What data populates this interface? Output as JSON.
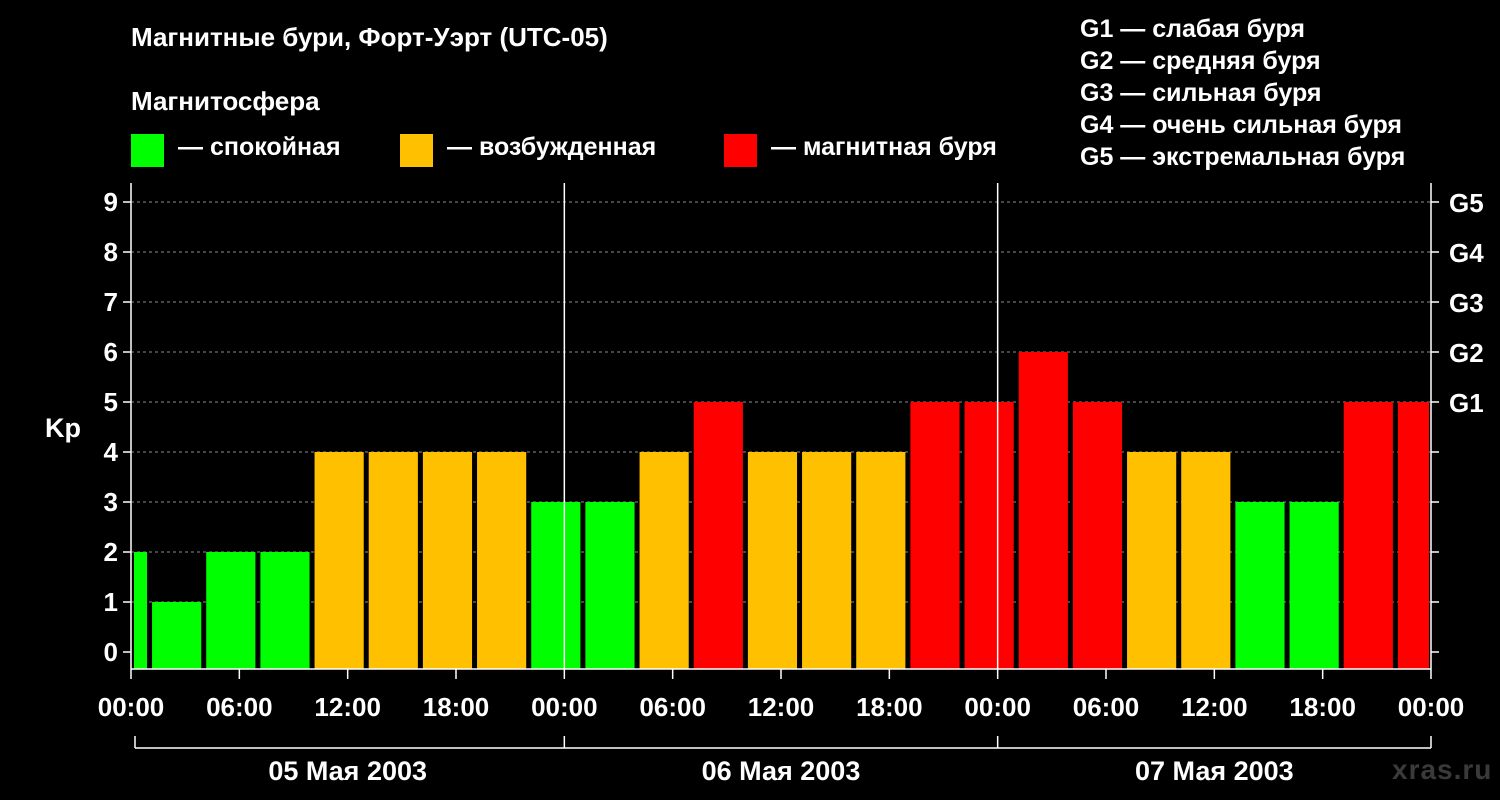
{
  "chart_data": {
    "type": "bar",
    "title": "Магнитные бури, Форт-Уэрт (UTC-05)",
    "subtitle": "Магнитосфера",
    "ylabel": "Kp",
    "ylim": [
      0,
      9
    ],
    "yticks": [
      "0",
      "1",
      "2",
      "3",
      "4",
      "5",
      "6",
      "7",
      "8",
      "9"
    ],
    "right_ticks": [
      {
        "kp": 5,
        "label": "G1"
      },
      {
        "kp": 6,
        "label": "G2"
      },
      {
        "kp": 7,
        "label": "G3"
      },
      {
        "kp": 8,
        "label": "G4"
      },
      {
        "kp": 9,
        "label": "G5"
      }
    ],
    "x_range_hours": [
      0,
      72
    ],
    "xticks": [
      {
        "hour": 0,
        "label": "00:00"
      },
      {
        "hour": 6,
        "label": "06:00"
      },
      {
        "hour": 12,
        "label": "12:00"
      },
      {
        "hour": 18,
        "label": "18:00"
      },
      {
        "hour": 24,
        "label": "00:00"
      },
      {
        "hour": 30,
        "label": "06:00"
      },
      {
        "hour": 36,
        "label": "12:00"
      },
      {
        "hour": 42,
        "label": "18:00"
      },
      {
        "hour": 48,
        "label": "00:00"
      },
      {
        "hour": 54,
        "label": "06:00"
      },
      {
        "hour": 60,
        "label": "12:00"
      },
      {
        "hour": 66,
        "label": "18:00"
      },
      {
        "hour": 72,
        "label": "00:00"
      }
    ],
    "days": [
      {
        "label": "05 Мая 2003",
        "start": 0,
        "end": 24
      },
      {
        "label": "06 Мая 2003",
        "start": 24,
        "end": 48
      },
      {
        "label": "07 Мая 2003",
        "start": 48,
        "end": 72
      }
    ],
    "grid": "dashed horizontal",
    "bars": [
      {
        "start": 0,
        "end": 1,
        "kp": 2
      },
      {
        "start": 1,
        "end": 4,
        "kp": 1
      },
      {
        "start": 4,
        "end": 7,
        "kp": 2
      },
      {
        "start": 7,
        "end": 10,
        "kp": 2
      },
      {
        "start": 10,
        "end": 13,
        "kp": 4
      },
      {
        "start": 13,
        "end": 16,
        "kp": 4
      },
      {
        "start": 16,
        "end": 19,
        "kp": 4
      },
      {
        "start": 19,
        "end": 22,
        "kp": 4
      },
      {
        "start": 22,
        "end": 25,
        "kp": 3
      },
      {
        "start": 25,
        "end": 28,
        "kp": 3
      },
      {
        "start": 28,
        "end": 31,
        "kp": 4
      },
      {
        "start": 31,
        "end": 34,
        "kp": 5
      },
      {
        "start": 34,
        "end": 37,
        "kp": 4
      },
      {
        "start": 37,
        "end": 40,
        "kp": 4
      },
      {
        "start": 40,
        "end": 43,
        "kp": 4
      },
      {
        "start": 43,
        "end": 46,
        "kp": 5
      },
      {
        "start": 46,
        "end": 49,
        "kp": 5
      },
      {
        "start": 49,
        "end": 52,
        "kp": 6
      },
      {
        "start": 52,
        "end": 55,
        "kp": 5
      },
      {
        "start": 55,
        "end": 58,
        "kp": 4
      },
      {
        "start": 58,
        "end": 61,
        "kp": 4
      },
      {
        "start": 61,
        "end": 64,
        "kp": 3
      },
      {
        "start": 64,
        "end": 67,
        "kp": 3
      },
      {
        "start": 67,
        "end": 70,
        "kp": 5
      },
      {
        "start": 70,
        "end": 72,
        "kp": 5
      }
    ]
  },
  "legend": [
    {
      "label": "— спокойная",
      "color": "#00ff00"
    },
    {
      "label": "— возбужденная",
      "color": "#ffc000"
    },
    {
      "label": "— магнитная буря",
      "color": "#ff0000"
    }
  ],
  "storm_scale": [
    "G1 — слабая буря",
    "G2 — средняя буря",
    "G3 — сильная буря",
    "G4 — очень сильная буря",
    "G5 — экстремальная буря"
  ],
  "watermark": "xras.ru"
}
